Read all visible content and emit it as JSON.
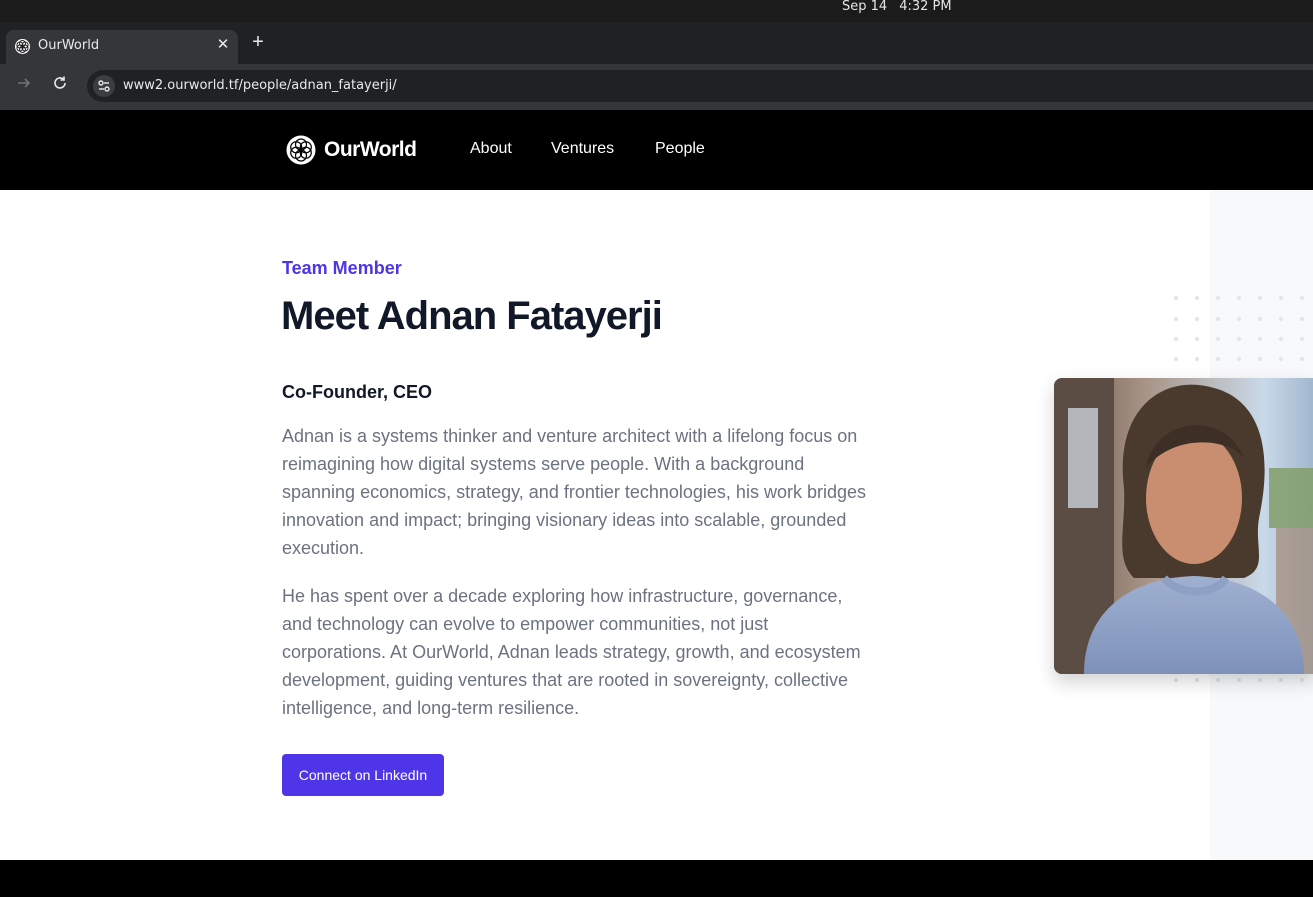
{
  "os": {
    "date": "Sep 14",
    "time": "4:32 PM"
  },
  "browser": {
    "tab_title": "OurWorld",
    "tab_close": "✕",
    "new_tab": "+",
    "url": "www2.ourworld.tf/people/adnan_fatayerji/"
  },
  "site": {
    "logo_text": "OurWorld",
    "nav": {
      "about": "About",
      "ventures": "Ventures",
      "people": "People"
    }
  },
  "profile": {
    "eyebrow": "Team Member",
    "title": "Meet Adnan Fatayerji",
    "role": "Co-Founder, CEO",
    "bio_1": "Adnan is a systems thinker and venture architect with a lifelong focus on reimagining how digital systems serve people. With a background spanning economics, strategy, and frontier technologies, his work bridges innovation and impact; bringing visionary ideas into scalable, grounded execution.",
    "bio_2": "He has spent over a decade exploring how infrastructure, governance, and technology can evolve to empower communities, not just corporations. At OurWorld, Adnan leads strategy, growth, and ecosystem development, guiding ventures that are rooted in sovereignty, collective intelligence, and long-term resilience.",
    "cta": "Connect on LinkedIn"
  },
  "colors": {
    "accent": "#4f35e8",
    "heading": "#111827",
    "body_text": "#6b7280"
  },
  "icons": {
    "favicon": "flower-logo-icon",
    "forward": "arrow-right-icon",
    "reload": "reload-icon",
    "site_info": "tune-icon"
  }
}
